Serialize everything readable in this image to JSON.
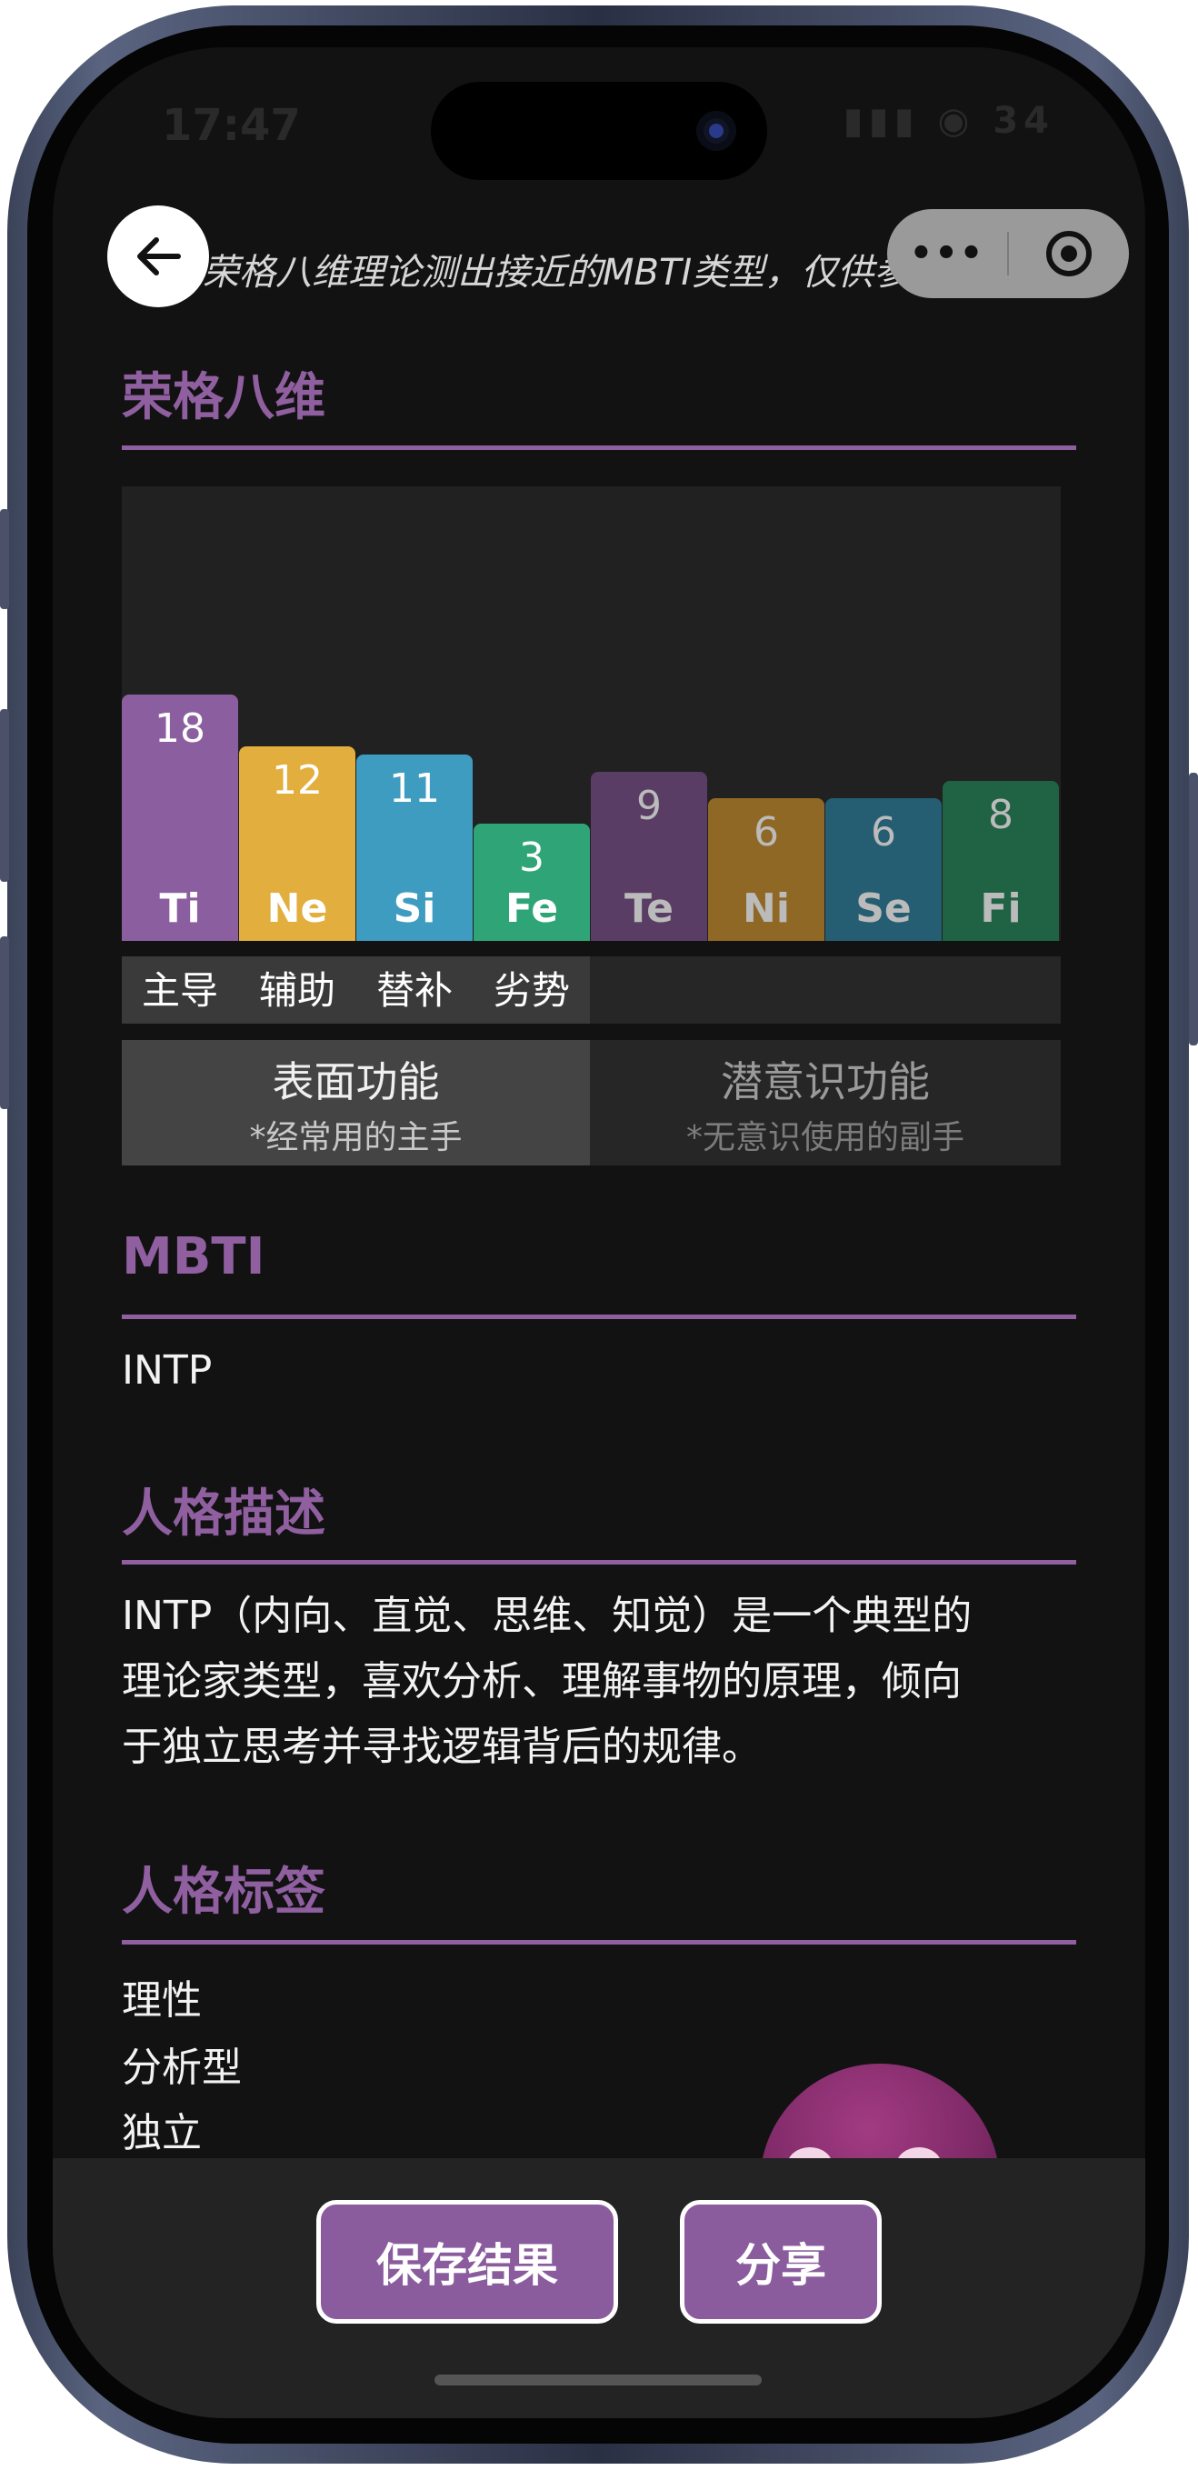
{
  "status_bar": {
    "time": "17:47",
    "icons": "▮▮▮ ◉ 34"
  },
  "header": {
    "note": "荣格八维理论测出接近的MBTI类型，仅供参考。",
    "back_icon": "arrow-left-icon",
    "more_icon": "•••",
    "target_icon": "target-icon"
  },
  "jung": {
    "title": "荣格八维",
    "bars": [
      {
        "name": "Ti",
        "value": 18,
        "color": "#8b5f9f",
        "dim": false
      },
      {
        "name": "Ne",
        "value": 12,
        "color": "#e2ae3d",
        "dim": false
      },
      {
        "name": "Si",
        "value": 11,
        "color": "#3f9cc1",
        "dim": false
      },
      {
        "name": "Fe",
        "value": 3,
        "color": "#2fa577",
        "dim": false
      },
      {
        "name": "Te",
        "value": 9,
        "color": "#5a3d64",
        "dim": true
      },
      {
        "name": "Ni",
        "value": 6,
        "color": "#8f6825",
        "dim": true
      },
      {
        "name": "Se",
        "value": 6,
        "color": "#255e72",
        "dim": true
      },
      {
        "name": "Fi",
        "value": 8,
        "color": "#1f6344",
        "dim": true
      }
    ],
    "roles": [
      "主导",
      "辅助",
      "替补",
      "劣势"
    ],
    "surface": {
      "title": "表面功能",
      "desc": "*经常用的主手"
    },
    "subconscious": {
      "title": "潜意识功能",
      "desc": "*无意识使用的副手"
    }
  },
  "mbti": {
    "title": "MBTI",
    "value": "INTP"
  },
  "description": {
    "title": "人格描述",
    "line1": "INTP（内向、直觉、思维、知觉）是一个典型的",
    "line2": "理论家类型，喜欢分析、理解事物的原理，倾向",
    "line3": "于独立思考并寻找逻辑背后的规律。"
  },
  "tags": {
    "title": "人格标签",
    "items": [
      "理性",
      "分析型",
      "独立"
    ]
  },
  "actions": {
    "save": "保存结果",
    "share": "分享"
  }
}
